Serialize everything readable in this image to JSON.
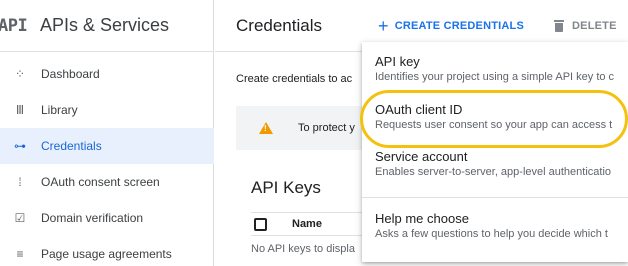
{
  "app": {
    "logo": "API",
    "title": "APIs & Services"
  },
  "sidebar": {
    "items": [
      {
        "label": "Dashboard",
        "icon": "dashboard-icon",
        "glyph": "⁘"
      },
      {
        "label": "Library",
        "icon": "library-icon",
        "glyph": "Ⅲ"
      },
      {
        "label": "Credentials",
        "icon": "key-icon",
        "glyph": "⊶",
        "active": true
      },
      {
        "label": "OAuth consent screen",
        "icon": "consent-icon",
        "glyph": "⁞"
      },
      {
        "label": "Domain verification",
        "icon": "domain-check-icon",
        "glyph": "☑"
      },
      {
        "label": "Page usage agreements",
        "icon": "settings-list-icon",
        "glyph": "≡"
      }
    ]
  },
  "header": {
    "title": "Credentials",
    "create_label": "CREATE CREDENTIALS",
    "delete_label": "DELETE"
  },
  "main": {
    "intro": "Create credentials to ac",
    "alert_text": "To protect y",
    "section_title": "API Keys",
    "column_name": "Name",
    "empty_text": "No API keys to displa"
  },
  "menu": {
    "items": [
      {
        "title": "API key",
        "desc": "Identifies your project using a simple API key to c"
      },
      {
        "title": "OAuth client ID",
        "desc": "Requests user consent so your app can access t"
      },
      {
        "title": "Service account",
        "desc": "Enables server-to-server, app-level authenticatio"
      },
      {
        "title": "Help me choose",
        "desc": "Asks a few questions to help you decide which t"
      }
    ]
  },
  "colors": {
    "accent": "#1a73e8",
    "active_bg": "#e8f0fe",
    "warning": "#f29900",
    "highlight": "#f4c20d"
  }
}
